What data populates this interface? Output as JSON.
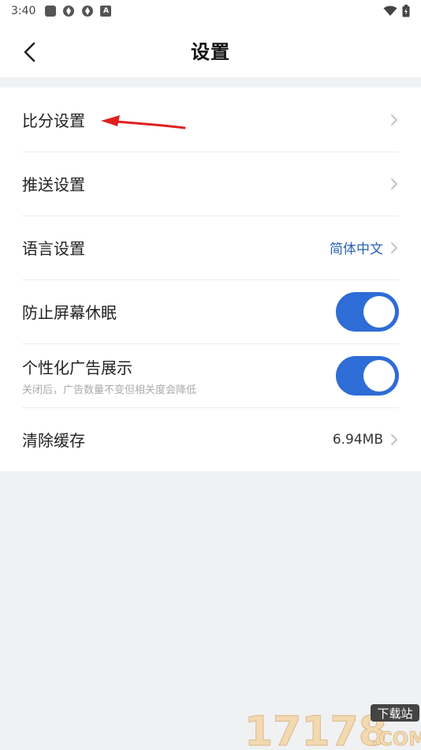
{
  "status_bar": {
    "time": "3:40",
    "indicator_icons": [
      "square-icon",
      "aperture-icon",
      "aperture-icon",
      "a-icon"
    ],
    "right_icons": [
      "wifi-icon",
      "battery-icon"
    ]
  },
  "header": {
    "title": "设置"
  },
  "settings": {
    "items": [
      {
        "label": "比分设置",
        "type": "link"
      },
      {
        "label": "推送设置",
        "type": "link"
      },
      {
        "label": "语言设置",
        "type": "link",
        "value": "简体中文"
      },
      {
        "label": "防止屏幕休眠",
        "type": "toggle",
        "on": true
      },
      {
        "label": "个性化广告展示",
        "type": "toggle",
        "on": true,
        "sublabel": "关闭后，广告数量不变但相关度会降低"
      },
      {
        "label": "清除缓存",
        "type": "link",
        "value": "6.94MB"
      }
    ]
  },
  "watermark": {
    "brand": "17178",
    "tag": "下载站",
    "domain": ".COM"
  },
  "colors": {
    "accent": "#2e6cd6",
    "link_value": "#2a63b8",
    "annotation": "#e02020",
    "background": "#f0f1f3"
  }
}
